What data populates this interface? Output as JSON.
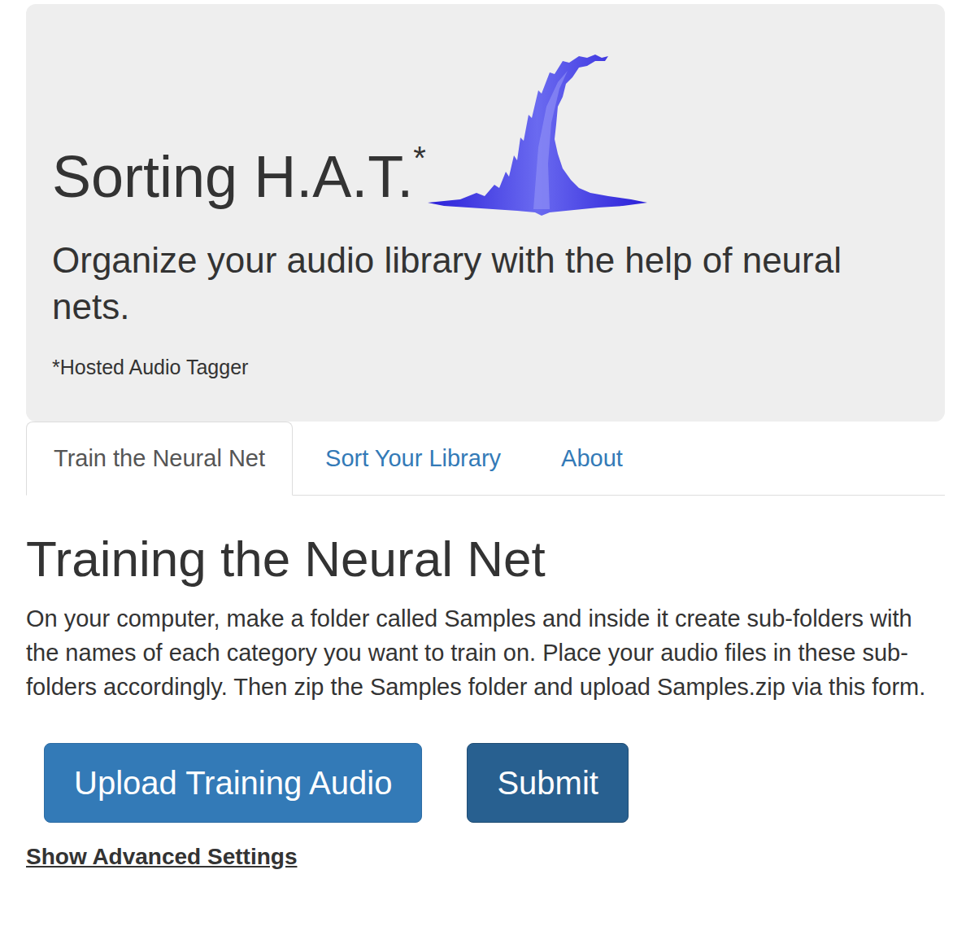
{
  "header": {
    "title": "Sorting H.A.T.",
    "title_mark": "*",
    "subtitle": "Organize your audio library with the help of neural nets.",
    "footnote": "*Hosted Audio Tagger"
  },
  "tabs": [
    {
      "label": "Train the Neural Net",
      "selected": true
    },
    {
      "label": "Sort Your Library",
      "selected": false
    },
    {
      "label": "About",
      "selected": false
    }
  ],
  "content": {
    "heading": "Training the Neural Net",
    "instructions": "On your computer, make a folder called Samples and inside it create sub-folders with the names of each category you want to train on. Place your audio files in these sub-folders accordingly. Then zip the Samples folder and upload Samples.zip via this form.",
    "buttons": [
      {
        "label": "Upload Training Audio",
        "kind": "upload"
      },
      {
        "label": "Submit",
        "kind": "submit"
      }
    ],
    "advanced_link": "Show Advanced Settings"
  }
}
